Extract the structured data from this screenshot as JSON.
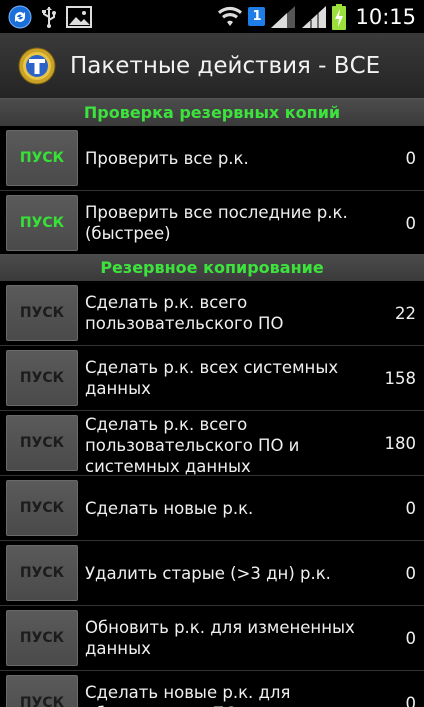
{
  "status_bar": {
    "time": "10:15",
    "sim_number": "1",
    "icons": [
      "sync-icon",
      "usb-icon",
      "image-icon",
      "wifi-icon",
      "sim-icon",
      "signal-icon",
      "signal-icon",
      "battery-icon"
    ]
  },
  "header": {
    "title": "Пакетные действия - ВСЕ",
    "app_icon": "titanium-backup-icon"
  },
  "colors": {
    "section_text": "#3de33d",
    "run_enabled": "#37e237",
    "run_disabled": "#1c1c1c"
  },
  "sections": [
    {
      "title": "Проверка резервных копий",
      "rows": [
        {
          "button": "ПУСК",
          "label": "Проверить все р.к.",
          "count": "0",
          "enabled": true
        },
        {
          "button": "ПУСК",
          "label": "Проверить все последние р.к. (быстрее)",
          "count": "0",
          "enabled": true
        }
      ]
    },
    {
      "title": "Резервное копирование",
      "rows": [
        {
          "button": "ПУСК",
          "label": "Сделать р.к. всего пользовательского ПО",
          "count": "22",
          "enabled": false
        },
        {
          "button": "ПУСК",
          "label": "Сделать р.к. всех системных данных",
          "count": "158",
          "enabled": false
        },
        {
          "button": "ПУСК",
          "label": "Сделать р.к. всего пользовательского ПО и системных данных",
          "count": "180",
          "enabled": false
        },
        {
          "button": "ПУСК",
          "label": "Сделать новые р.к.",
          "count": "0",
          "enabled": false
        },
        {
          "button": "ПУСК",
          "label": "Удалить старые (>3 дн) р.к.",
          "count": "0",
          "enabled": false
        },
        {
          "button": "ПУСК",
          "label": "Обновить р.к. для измененных данных",
          "count": "0",
          "enabled": false
        },
        {
          "button": "ПУСК",
          "label": "Сделать новые р.к. для обновленного ПО",
          "count": "0",
          "enabled": false
        }
      ]
    }
  ]
}
